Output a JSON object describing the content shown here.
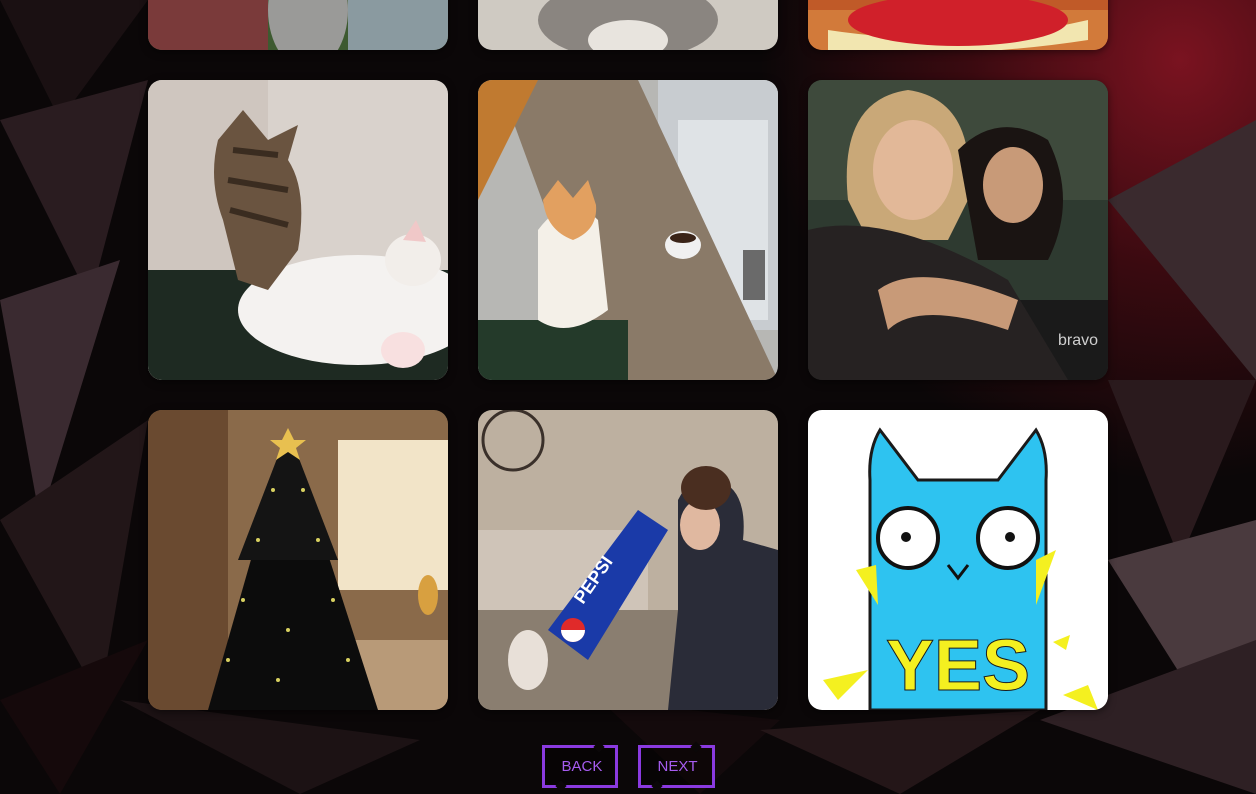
{
  "gallery": {
    "tiles": [
      {
        "name": "gif-tile-tabby-cat-outdoors",
        "alt": "gif",
        "caption": ""
      },
      {
        "name": "gif-tile-cat-on-lace",
        "alt": "gif",
        "caption": ""
      },
      {
        "name": "gif-tile-red-cake",
        "alt": "gif",
        "caption": ""
      },
      {
        "name": "gif-tile-kitten-massage",
        "alt": "gif",
        "caption": ""
      },
      {
        "name": "gif-tile-cat-at-cafe-counter",
        "alt": "gif",
        "caption": ""
      },
      {
        "name": "gif-tile-women-hug",
        "alt": "gif",
        "caption": "bravo"
      },
      {
        "name": "gif-tile-cat-christmas-tree",
        "alt": "gif",
        "caption": ""
      },
      {
        "name": "gif-tile-woman-pepsi-box-cat",
        "alt": "gif",
        "caption": "PEPSI"
      },
      {
        "name": "gif-tile-blue-cat-yes",
        "alt": "gif",
        "caption": "YES"
      }
    ]
  },
  "pager": {
    "back_label": "BACK",
    "next_label": "NEXT"
  },
  "colors": {
    "accent": "#8a3ae0",
    "accent_text": "#a65cf0",
    "background": "#0b0708",
    "background_glow": "#5a0f18"
  }
}
